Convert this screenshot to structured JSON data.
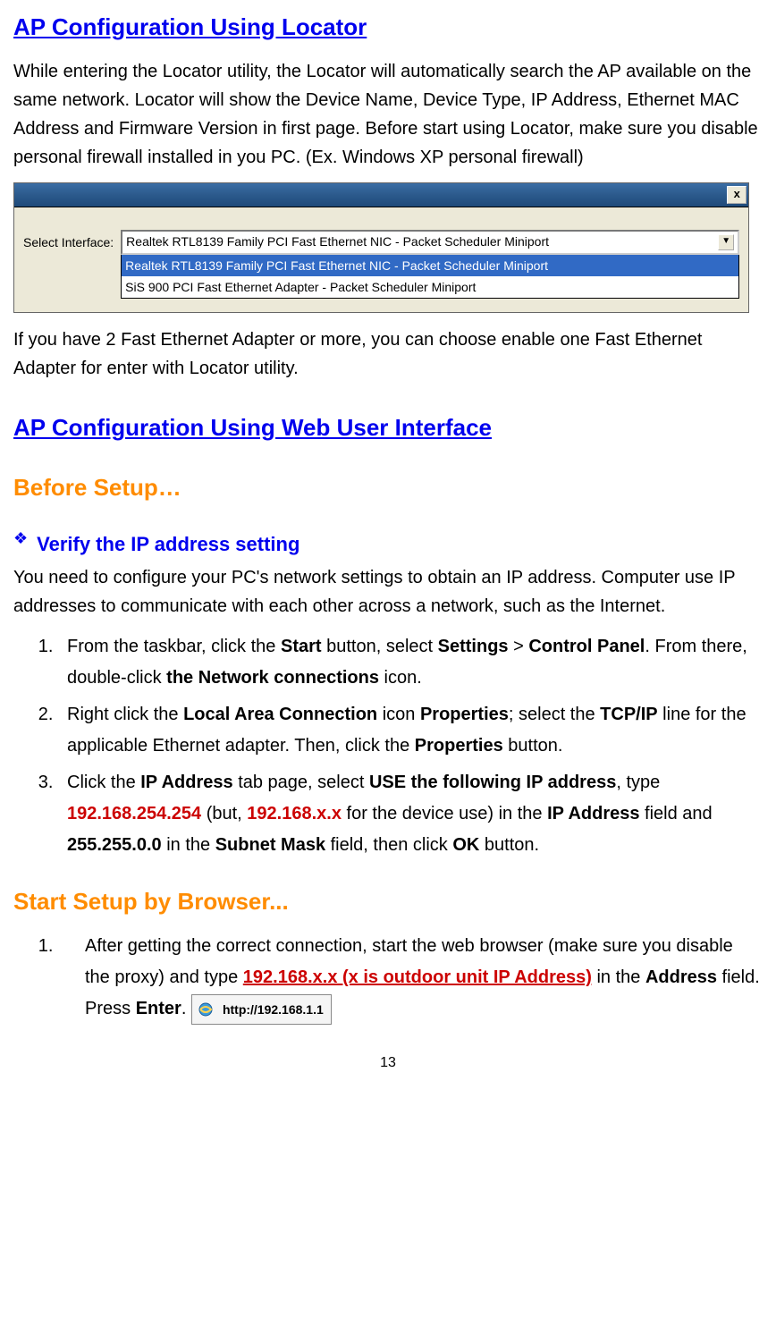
{
  "heading1": "AP Configuration Using Locator",
  "para1": "While entering the Locator utility, the Locator will automatically search the AP available on the same network. Locator will show the Device Name, Device Type, IP Address, Ethernet MAC Address and Firmware Version in first page. Before start using Locator, make sure you disable personal firewall installed in you PC. (Ex. Windows XP personal firewall)",
  "dialog": {
    "close": "x",
    "label": "Select Interface:",
    "selected": "Realtek RTL8139 Family PCI Fast Ethernet NIC - Packet Scheduler Miniport",
    "opt_highlight": "Realtek RTL8139 Family PCI Fast Ethernet NIC - Packet Scheduler Miniport",
    "opt2": "SiS 900 PCI Fast Ethernet Adapter - Packet Scheduler Miniport"
  },
  "para2": "If you have 2 Fast Ethernet Adapter or more, you can choose enable one Fast Ethernet Adapter for enter with Locator utility.",
  "heading2": "AP Configuration Using Web User Interface",
  "heading3": "Before Setup…",
  "bullet_sym": "❖",
  "subheading1": "Verify the IP address setting",
  "para3": "You need to configure your PC's network settings to obtain an IP address. Computer use IP addresses to communicate with each other across a network, such as the Internet.",
  "list1": {
    "i1": {
      "t1": "From the taskbar, click the ",
      "b1": "Start",
      "t2": " button, select ",
      "b2": "Settings",
      "t3": " > ",
      "b3": "Control Panel",
      "t4": ". From there, double-click ",
      "b4": "the Network connections",
      "t5": " icon."
    },
    "i2": {
      "t1": "Right click the ",
      "b1": "Local Area Connection",
      "t2": " icon ",
      "b2": "Properties",
      "t3": "; select the ",
      "b3": "TCP/IP",
      "t4": " line for the applicable Ethernet adapter. Then, click the ",
      "b4": "Properties",
      "t5": " button."
    },
    "i3": {
      "t1": "Click the ",
      "b1": "IP Address",
      "t2": " tab page, select ",
      "b2": "USE the following IP address",
      "t3": ", type ",
      "r1": "192.168.254.254",
      "t4": " (but, ",
      "r2": "192.168.x.x",
      "t5": " for the device use) in the ",
      "b3": "IP Address",
      "t6": " field and ",
      "b4": "255.255.0.0",
      "t7": " in the ",
      "b5": "Subnet Mask",
      "t8": " field, then click ",
      "b6": "OK",
      "t9": " button."
    }
  },
  "heading4": "Start Setup by Browser...",
  "list2": {
    "i1": {
      "t1": "After getting the correct connection, start the web browser (make sure you disable the proxy) and type ",
      "ru1": "192.168.x.x (x is outdoor unit IP Address)",
      "t2": " in the ",
      "b1": "Address",
      "t3": " field. Press ",
      "b2": "Enter",
      "t4": "."
    }
  },
  "ie_url": "http://192.168.1.1",
  "page_number": "13"
}
